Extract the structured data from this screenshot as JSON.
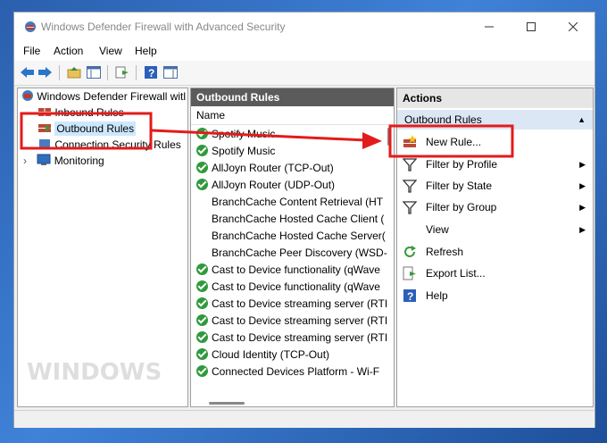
{
  "window": {
    "title": "Windows Defender Firewall with Advanced Security"
  },
  "menu": [
    "File",
    "Action",
    "View",
    "Help"
  ],
  "tree": {
    "root": "Windows Defender Firewall witl",
    "items": [
      {
        "label": "Inbound Rules"
      },
      {
        "label": "Outbound Rules"
      },
      {
        "label": "Connection Security Rules"
      },
      {
        "label": "Monitoring"
      }
    ]
  },
  "center": {
    "header": "Outbound Rules",
    "column": "Name",
    "rules": [
      {
        "name": "Spotify Music",
        "enabled": true
      },
      {
        "name": "Spotify Music",
        "enabled": true
      },
      {
        "name": "AllJoyn Router (TCP-Out)",
        "enabled": true
      },
      {
        "name": "AllJoyn Router (UDP-Out)",
        "enabled": true
      },
      {
        "name": "BranchCache Content Retrieval (HT",
        "enabled": false
      },
      {
        "name": "BranchCache Hosted Cache Client (",
        "enabled": false
      },
      {
        "name": "BranchCache Hosted Cache Server(",
        "enabled": false
      },
      {
        "name": "BranchCache Peer Discovery (WSD-",
        "enabled": false
      },
      {
        "name": "Cast to Device functionality (qWave",
        "enabled": true
      },
      {
        "name": "Cast to Device functionality (qWave",
        "enabled": true
      },
      {
        "name": "Cast to Device streaming server (RTI",
        "enabled": true
      },
      {
        "name": "Cast to Device streaming server (RTI",
        "enabled": true
      },
      {
        "name": "Cast to Device streaming server (RTI",
        "enabled": true
      },
      {
        "name": "Cloud Identity (TCP-Out)",
        "enabled": true
      },
      {
        "name": "Connected Devices Platform - Wi-F",
        "enabled": true
      }
    ]
  },
  "actions": {
    "header": "Actions",
    "section": "Outbound Rules",
    "items": [
      {
        "label": "New Rule...",
        "icon": "new-rule-icon",
        "submenu": false
      },
      {
        "label": "Filter by Profile",
        "icon": "filter-icon",
        "submenu": true
      },
      {
        "label": "Filter by State",
        "icon": "filter-icon",
        "submenu": true
      },
      {
        "label": "Filter by Group",
        "icon": "filter-icon",
        "submenu": true
      },
      {
        "label": "View",
        "icon": "",
        "submenu": true
      },
      {
        "label": "Refresh",
        "icon": "refresh-icon",
        "submenu": false
      },
      {
        "label": "Export List...",
        "icon": "export-icon",
        "submenu": false
      },
      {
        "label": "Help",
        "icon": "help-icon",
        "submenu": false
      }
    ]
  },
  "watermark": "WINDOWS",
  "colors": {
    "highlight": "#e31b1b",
    "header": "#5b5b5b",
    "selection": "#cce8ff",
    "check": "#2f9a3b"
  }
}
